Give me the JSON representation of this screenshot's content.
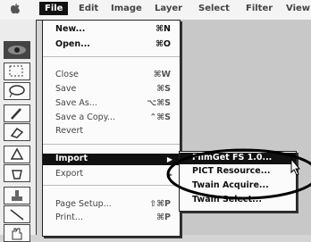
{
  "menubar": {
    "items": [
      "File",
      "Edit",
      "Image",
      "Layer",
      "Select",
      "Filter",
      "View"
    ]
  },
  "file_menu": {
    "items": [
      {
        "label": "New...",
        "shortcut": "⌘N"
      },
      {
        "label": "Open...",
        "shortcut": "⌘O"
      },
      {
        "label": "Close",
        "shortcut": "⌘W"
      },
      {
        "label": "Save",
        "shortcut": "⌘S"
      },
      {
        "label": "Save As...",
        "shortcut": "⌥⌘S"
      },
      {
        "label": "Save a Copy...",
        "shortcut": "⌃⌘S"
      },
      {
        "label": "Revert",
        "shortcut": ""
      },
      {
        "label": "Import",
        "shortcut": ""
      },
      {
        "label": "Export",
        "shortcut": ""
      },
      {
        "label": "Page Setup...",
        "shortcut": "⇧⌘P"
      },
      {
        "label": "Print...",
        "shortcut": "⌘P"
      }
    ],
    "submenu_arrow": "▶"
  },
  "import_submenu": {
    "items": [
      "FilmGet FS 1.0...",
      "PICT Resource...",
      "Twain Acquire...",
      "Twain Select..."
    ]
  }
}
